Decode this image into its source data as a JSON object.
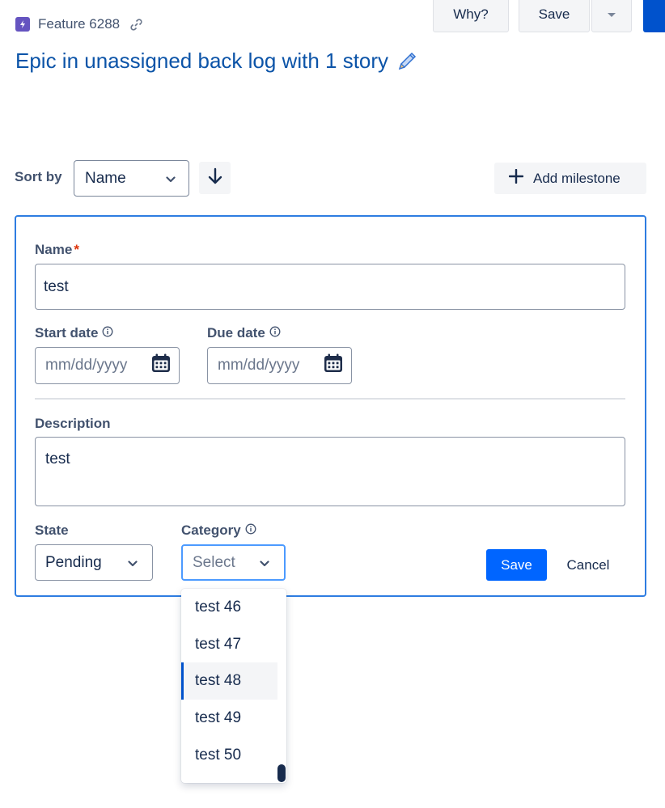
{
  "header": {
    "breadcrumb": "Feature 6288",
    "title": "Epic in unassigned back log with 1 story",
    "why_label": "Why?",
    "save_label": "Save"
  },
  "sort": {
    "label": "Sort by",
    "value": "Name",
    "add_milestone_label": "Add milestone"
  },
  "form": {
    "name_label": "Name",
    "required_marker": "*",
    "name_value": "test",
    "start_date_label": "Start date",
    "start_date_placeholder": "mm/dd/yyyy",
    "due_date_label": "Due date",
    "due_date_placeholder": "mm/dd/yyyy",
    "description_label": "Description",
    "description_value": "test",
    "state_label": "State",
    "state_value": "Pending",
    "category_label": "Category",
    "category_placeholder": "Select",
    "save_label": "Save",
    "cancel_label": "Cancel"
  },
  "category_menu": {
    "options": [
      "test 46",
      "test 47",
      "test 48",
      "test 49",
      "test 50"
    ],
    "highlighted": "test 48"
  },
  "colors": {
    "accent": "#0052cc",
    "title": "#0c54a8",
    "focus_border": "#2e7de1",
    "primary_button": "#0065ff",
    "feature_icon": "#6554c0",
    "required": "#de350b"
  }
}
